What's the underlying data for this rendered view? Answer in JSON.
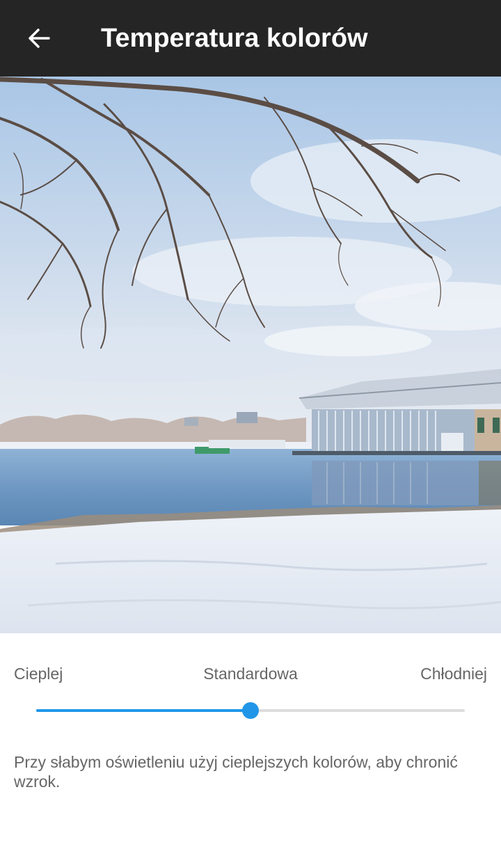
{
  "header": {
    "title": "Temperatura kolorów",
    "back_icon": "arrow-left-icon"
  },
  "preview": {
    "scene": "snowy lake with pavilion under bare tree branches"
  },
  "temperature": {
    "warmer_label": "Cieplej",
    "standard_label": "Standardowa",
    "cooler_label": "Chłodniej",
    "value": 0.5,
    "accent_color": "#2196E8"
  },
  "hint": "Przy słabym oświetleniu użyj cieplejszych kolorów, aby chronić wzrok.",
  "colors": {
    "app_bar": "#252525",
    "text_secondary": "#666666",
    "track": "#DDDDDD"
  }
}
